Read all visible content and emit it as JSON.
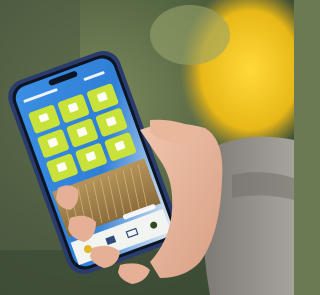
{
  "app": {
    "header_title": "",
    "tiles": [
      {
        "icon": "home-icon",
        "glyph": "⌂"
      },
      {
        "icon": "calendar-icon",
        "glyph": "▦"
      },
      {
        "icon": "document-icon",
        "glyph": "▤"
      },
      {
        "icon": "chart-icon",
        "glyph": "▥"
      },
      {
        "icon": "star-icon",
        "glyph": "✶"
      },
      {
        "icon": "gear-icon",
        "glyph": "✱"
      },
      {
        "icon": "clipboard-icon",
        "glyph": "▣"
      },
      {
        "icon": "leaf-icon",
        "glyph": "❦"
      },
      {
        "icon": "bookmark-icon",
        "glyph": "▮"
      }
    ],
    "tabbar": [
      {
        "icon": "home-icon",
        "glyph": "⌂",
        "label": ""
      },
      {
        "icon": "people-icon",
        "glyph": "☗",
        "label": ""
      },
      {
        "icon": "mail-icon",
        "glyph": "✉",
        "label": ""
      },
      {
        "icon": "gear-icon",
        "glyph": "✿",
        "label": ""
      }
    ]
  },
  "colors": {
    "tile_green": "#c9e23a",
    "screen_blue": "#2f7fd6",
    "phone_frame": "#2a3c6e",
    "background_yellow": "#f2c21c",
    "sweater_gray": "#8e8a86"
  }
}
